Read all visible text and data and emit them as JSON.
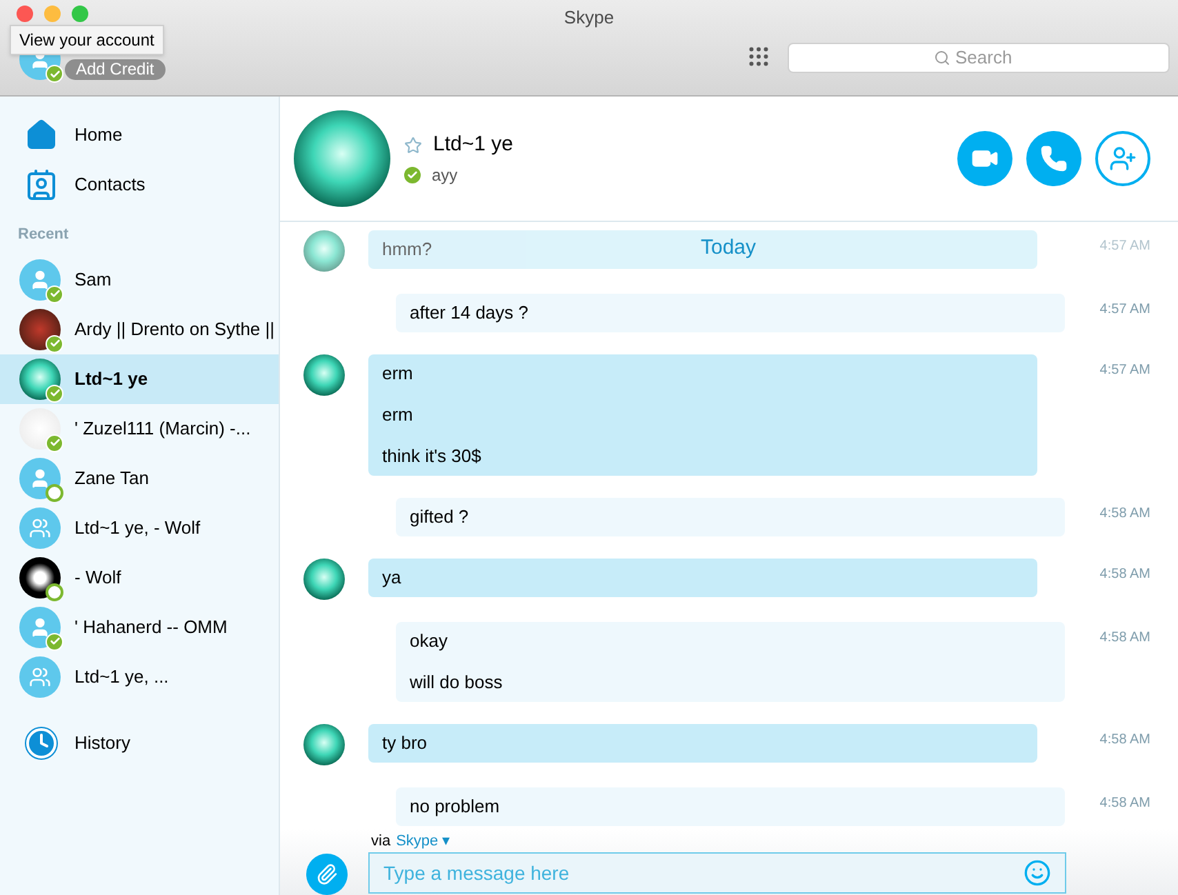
{
  "window": {
    "title": "Skype"
  },
  "account": {
    "tooltip": "View your account",
    "credit_button": "Add Credit",
    "online": true
  },
  "search": {
    "placeholder": "Search"
  },
  "nav": [
    {
      "label": "Home",
      "kind": "home"
    },
    {
      "label": "Contacts",
      "kind": "contacts"
    }
  ],
  "recent": {
    "heading": "Recent",
    "items": [
      {
        "name": "Sam",
        "kind": "person",
        "online": true,
        "selected": false
      },
      {
        "name": "Ardy || Drento on Sythe ||",
        "kind": "photo",
        "online": true,
        "selected": false
      },
      {
        "name": "Ltd~1 ye",
        "kind": "photo",
        "online": true,
        "selected": true
      },
      {
        "name": "' Zuzel111 (Marcin) -...",
        "kind": "photo",
        "online": true,
        "selected": false
      },
      {
        "name": "Zane Tan",
        "kind": "person",
        "online": false,
        "selected": false
      },
      {
        "name": "Ltd~1 ye, - Wolf",
        "kind": "group",
        "selected": false
      },
      {
        "name": "- Wolf",
        "kind": "photo",
        "online": false,
        "selected": false
      },
      {
        "name": "' Hahanerd -- OMM",
        "kind": "person",
        "online": true,
        "selected": false
      },
      {
        "name": "Ltd~1 ye, ...",
        "kind": "group",
        "selected": false
      }
    ]
  },
  "history": {
    "label": "History"
  },
  "conversation": {
    "name": "Ltd~1 ye",
    "mood": "ayy",
    "online": true,
    "favorite": false
  },
  "date_divider": "Today",
  "messages": [
    {
      "kind": "incoming",
      "faded": true,
      "lines": [
        "hmm?"
      ],
      "time": "4:57 AM"
    },
    {
      "kind": "outgoing",
      "faded": false,
      "lines": [
        "after 14 days ?"
      ],
      "time": "4:57 AM"
    },
    {
      "kind": "incoming",
      "faded": false,
      "lines": [
        "erm",
        "erm",
        "think it's 30$"
      ],
      "time": "4:57 AM"
    },
    {
      "kind": "outgoing",
      "faded": false,
      "lines": [
        "gifted ?"
      ],
      "time": "4:58 AM"
    },
    {
      "kind": "incoming",
      "faded": false,
      "lines": [
        "ya"
      ],
      "time": "4:58 AM"
    },
    {
      "kind": "outgoing",
      "faded": false,
      "lines": [
        "okay",
        "will do boss"
      ],
      "time": "4:58 AM"
    },
    {
      "kind": "incoming",
      "faded": false,
      "lines": [
        "ty bro"
      ],
      "time": "4:58 AM"
    },
    {
      "kind": "outgoing",
      "faded": false,
      "lines": [
        "no problem"
      ],
      "time": "4:58 AM"
    }
  ],
  "composer": {
    "via_prefix": "via",
    "via_service": "Skype",
    "via_caret": "▾",
    "placeholder": "Type a message here"
  }
}
